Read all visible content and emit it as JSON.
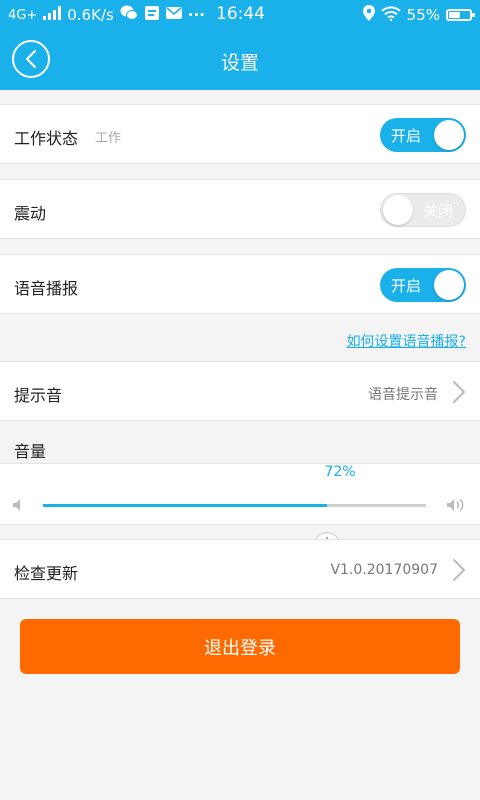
{
  "status_bar": {
    "network": "4G+",
    "speed": "0.6K/s",
    "time": "16:44",
    "battery_percent": "55%",
    "battery_level": 0.55,
    "more": "···",
    "icons": [
      "signal-icon",
      "wechat-icon",
      "notification-icon",
      "mail-icon",
      "location-icon",
      "wifi-icon",
      "battery-icon"
    ]
  },
  "header": {
    "title": "设置",
    "back_icon": "back-circle-icon"
  },
  "settings": {
    "work_status": {
      "label": "工作状态",
      "sub": "工作",
      "toggle_label": "开启",
      "on": true
    },
    "vibration": {
      "label": "震动",
      "toggle_label": "关闭",
      "on": false
    },
    "voice_broadcast": {
      "label": "语音播报",
      "toggle_label": "开启",
      "on": true
    },
    "help_link": "如何设置语音播报?",
    "prompt_sound": {
      "label": "提示音",
      "value": "语音提示音"
    },
    "volume": {
      "label": "音量",
      "percent_text": "72%",
      "level": 0.72
    },
    "check_update": {
      "label": "检查更新",
      "value": "V1.0.20170907"
    }
  },
  "logout": {
    "label": "退出登录"
  },
  "colors": {
    "primary": "#1ab0ea",
    "accent": "#ff6a00",
    "background": "#f4f4f4"
  }
}
